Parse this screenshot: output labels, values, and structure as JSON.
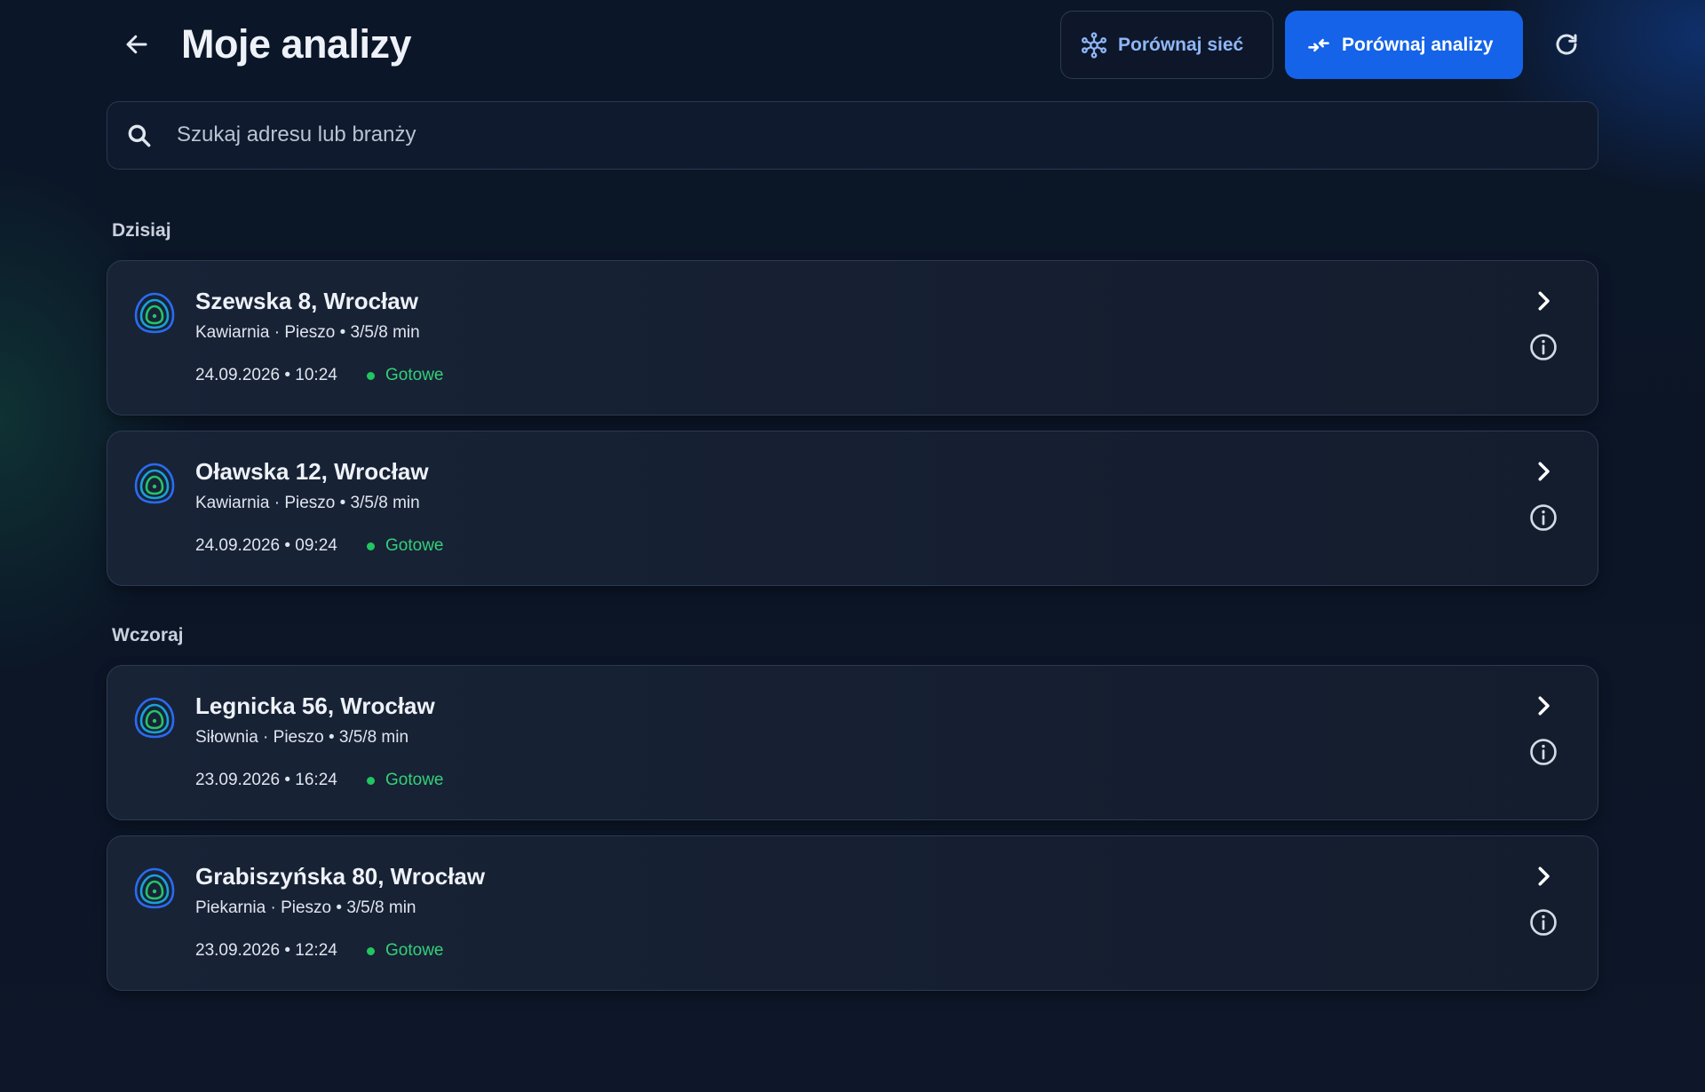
{
  "header": {
    "title": "Moje analizy",
    "compare_network_label": "Porównaj sieć",
    "compare_analyses_label": "Porównaj analizy"
  },
  "search": {
    "placeholder": "Szukaj adresu lub branży",
    "value": ""
  },
  "colors": {
    "accent": "#1463e8",
    "status_ready": "#22c55e",
    "background": "#0b1628"
  },
  "icons": {
    "back": "arrow-left-icon",
    "network": "network-icon",
    "compare": "compare-arrows-icon",
    "refresh": "refresh-icon",
    "search": "search-icon",
    "isochrone": "isochrone-map-icon",
    "chevron": "chevron-right-icon",
    "info": "info-icon"
  },
  "groups": [
    {
      "title": "Dzisiaj",
      "items": [
        {
          "address": "Szewska 8, Wrocław",
          "details": "Kawiarnia · Pieszo • 3/5/8 min",
          "datetime": "24.09.2026 • 10:24",
          "status": "Gotowe"
        },
        {
          "address": "Oławska 12, Wrocław",
          "details": "Kawiarnia · Pieszo • 3/5/8 min",
          "datetime": "24.09.2026 • 09:24",
          "status": "Gotowe"
        }
      ]
    },
    {
      "title": "Wczoraj",
      "items": [
        {
          "address": "Legnicka 56, Wrocław",
          "details": "Siłownia · Pieszo • 3/5/8 min",
          "datetime": "23.09.2026 • 16:24",
          "status": "Gotowe"
        },
        {
          "address": "Grabiszyńska 80, Wrocław",
          "details": "Piekarnia · Pieszo • 3/5/8 min",
          "datetime": "23.09.2026 • 12:24",
          "status": "Gotowe"
        }
      ]
    }
  ]
}
